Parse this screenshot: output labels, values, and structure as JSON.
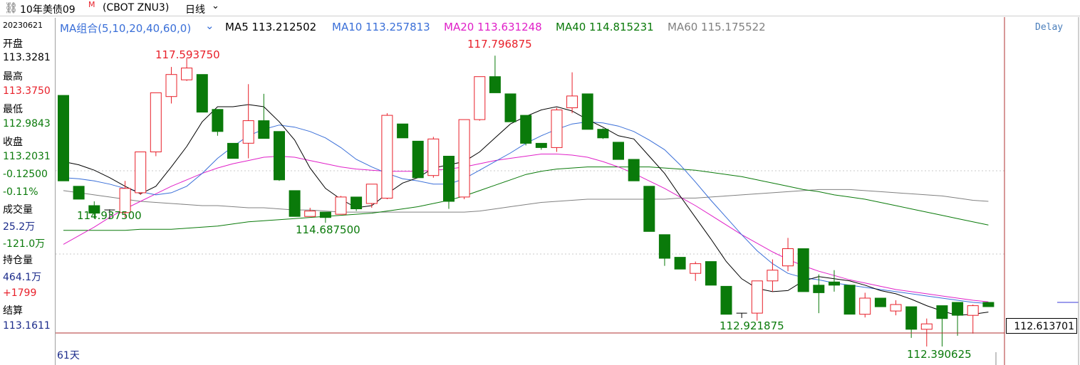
{
  "header": {
    "title": "10年美债09",
    "title_mark": "M",
    "symbol": "(CBOT ZNU3)",
    "period": "日线"
  },
  "sidebar": {
    "date": "20230621",
    "open_label": "开盘",
    "open_value": "113.3281",
    "high_label": "最高",
    "high_value": "113.3750",
    "low_label": "最低",
    "low_value": "112.9843",
    "close_label": "收盘",
    "close_value": "113.2031",
    "change": "-0.12500",
    "change_pct": "-0.11%",
    "volume_label": "成交量",
    "volume_value": "25.2万",
    "volume_change": "-121.0万",
    "oi_label": "持仓量",
    "oi_value": "464.1万",
    "oi_change": "+1799",
    "settle_label": "结算",
    "settle_value": "113.1611"
  },
  "legend": {
    "group": "MA组合(5,10,20,40,60,0)",
    "ma5": "MA5 113.212502",
    "ma10": "MA10 113.257813",
    "ma20": "MA20 113.631248",
    "ma40": "MA40 114.815231",
    "ma60": "MA60 115.175522"
  },
  "delay": "Delay",
  "days": "61天",
  "price_box": "112.613701",
  "annotations": {
    "a1": "117.593750",
    "a2": "117.796875",
    "a3": "114.937500",
    "a4": "114.687500",
    "a5": "112.921875",
    "a6": "112.390625"
  },
  "colors": {
    "up": "#e8202a",
    "down": "#0a7a0a",
    "ma5": "#000000",
    "ma10": "#3a6fd8",
    "ma20": "#e020c8",
    "ma40": "#0a7a0a",
    "ma60": "#808080"
  },
  "chart_data": {
    "type": "candlestick",
    "ylim": [
      112.35,
      118.2
    ],
    "candles": [
      {
        "o": 117.06,
        "h": 117.06,
        "c": 115.47,
        "l": 115.47
      },
      {
        "o": 115.37,
        "h": 115.37,
        "c": 115.13,
        "l": 115.13
      },
      {
        "o": 115.01,
        "h": 115.09,
        "c": 114.87,
        "l": 114.77
      },
      {
        "o": 114.93,
        "h": 114.94,
        "c": 114.93,
        "l": 114.77
      },
      {
        "o": 114.88,
        "h": 115.47,
        "c": 115.33,
        "l": 114.79
      },
      {
        "o": 115.25,
        "h": 116.01,
        "c": 116.01,
        "l": 115.21
      },
      {
        "o": 116.01,
        "h": 117.11,
        "c": 117.11,
        "l": 115.93
      },
      {
        "o": 117.04,
        "h": 117.59,
        "c": 117.45,
        "l": 116.91
      },
      {
        "o": 117.35,
        "h": 117.76,
        "c": 117.57,
        "l": 117.33
      },
      {
        "o": 117.45,
        "h": 117.45,
        "c": 116.75,
        "l": 116.75
      },
      {
        "o": 116.8,
        "h": 116.8,
        "c": 116.39,
        "l": 116.31
      },
      {
        "o": 116.17,
        "h": 116.17,
        "c": 115.89,
        "l": 115.89
      },
      {
        "o": 116.17,
        "h": 117.27,
        "c": 116.59,
        "l": 115.89
      },
      {
        "o": 116.59,
        "h": 117.09,
        "c": 116.26,
        "l": 116.26
      },
      {
        "o": 116.39,
        "h": 116.39,
        "c": 115.49,
        "l": 115.47
      },
      {
        "o": 115.29,
        "h": 115.29,
        "c": 114.81,
        "l": 114.81
      },
      {
        "o": 114.81,
        "h": 114.97,
        "c": 114.91,
        "l": 114.81
      },
      {
        "o": 114.89,
        "h": 114.89,
        "c": 114.79,
        "l": 114.69
      },
      {
        "o": 114.85,
        "h": 115.19,
        "c": 115.17,
        "l": 114.87
      },
      {
        "o": 115.17,
        "h": 115.17,
        "c": 114.95,
        "l": 114.91
      },
      {
        "o": 115.05,
        "h": 115.41,
        "c": 115.41,
        "l": 114.97
      },
      {
        "o": 115.15,
        "h": 116.73,
        "c": 116.69,
        "l": 115.13
      },
      {
        "o": 116.53,
        "h": 116.53,
        "c": 116.27,
        "l": 116.27
      },
      {
        "o": 116.21,
        "h": 116.21,
        "c": 115.53,
        "l": 115.53
      },
      {
        "o": 115.57,
        "h": 116.29,
        "c": 116.25,
        "l": 115.53
      },
      {
        "o": 115.93,
        "h": 115.93,
        "c": 115.09,
        "l": 114.95
      },
      {
        "o": 115.17,
        "h": 116.61,
        "c": 116.61,
        "l": 115.13
      },
      {
        "o": 116.61,
        "h": 117.41,
        "c": 117.41,
        "l": 116.59
      },
      {
        "o": 117.41,
        "h": 117.8,
        "c": 117.11,
        "l": 117.11
      },
      {
        "o": 117.09,
        "h": 117.09,
        "c": 116.57,
        "l": 116.57
      },
      {
        "o": 116.69,
        "h": 116.69,
        "c": 116.17,
        "l": 116.13
      },
      {
        "o": 116.17,
        "h": 116.17,
        "c": 116.09,
        "l": 116.05
      },
      {
        "o": 116.09,
        "h": 116.83,
        "c": 116.79,
        "l": 116.01
      },
      {
        "o": 116.83,
        "h": 117.49,
        "c": 117.05,
        "l": 116.73
      },
      {
        "o": 117.09,
        "h": 117.09,
        "c": 116.43,
        "l": 116.43
      },
      {
        "o": 116.43,
        "h": 116.45,
        "c": 116.27,
        "l": 116.25
      },
      {
        "o": 116.19,
        "h": 116.19,
        "c": 115.87,
        "l": 115.87
      },
      {
        "o": 115.87,
        "h": 115.87,
        "c": 115.47,
        "l": 115.47
      },
      {
        "o": 115.37,
        "h": 115.37,
        "c": 114.53,
        "l": 114.53
      },
      {
        "o": 114.47,
        "h": 114.47,
        "c": 114.03,
        "l": 113.89
      },
      {
        "o": 114.05,
        "h": 114.05,
        "c": 113.83,
        "l": 113.83
      },
      {
        "o": 113.75,
        "h": 113.97,
        "c": 113.93,
        "l": 113.61
      },
      {
        "o": 113.97,
        "h": 113.97,
        "c": 113.53,
        "l": 113.53
      },
      {
        "o": 113.51,
        "h": 113.51,
        "c": 112.99,
        "l": 112.99
      },
      {
        "o": 113.01,
        "h": 113.01,
        "c": 113.01,
        "l": 112.92
      },
      {
        "o": 113.01,
        "h": 113.59,
        "c": 113.61,
        "l": 112.87
      },
      {
        "o": 113.61,
        "h": 114.01,
        "c": 113.81,
        "l": 113.41
      },
      {
        "o": 113.89,
        "h": 114.41,
        "c": 114.21,
        "l": 113.79
      },
      {
        "o": 114.21,
        "h": 114.21,
        "c": 113.41,
        "l": 113.41
      },
      {
        "o": 113.53,
        "h": 113.73,
        "c": 113.39,
        "l": 113.01
      },
      {
        "o": 113.59,
        "h": 113.81,
        "c": 113.53,
        "l": 113.41
      },
      {
        "o": 113.53,
        "h": 113.53,
        "c": 112.99,
        "l": 112.99
      },
      {
        "o": 112.99,
        "h": 113.39,
        "c": 113.29,
        "l": 112.93
      },
      {
        "o": 113.29,
        "h": 113.29,
        "c": 113.13,
        "l": 113.13
      },
      {
        "o": 113.05,
        "h": 113.25,
        "c": 113.17,
        "l": 112.97
      },
      {
        "o": 113.13,
        "h": 113.13,
        "c": 112.71,
        "l": 112.55
      },
      {
        "o": 112.71,
        "h": 112.91,
        "c": 112.81,
        "l": 112.39
      },
      {
        "o": 113.15,
        "h": 113.15,
        "c": 112.91,
        "l": 112.39
      },
      {
        "o": 113.21,
        "h": 113.21,
        "c": 112.97,
        "l": 112.59
      },
      {
        "o": 112.97,
        "h": 113.17,
        "c": 113.15,
        "l": 112.63
      },
      {
        "o": 113.21,
        "h": 113.21,
        "c": 113.13,
        "l": 113.13
      }
    ],
    "ma5": [
      115.83,
      115.77,
      115.67,
      115.53,
      115.37,
      115.23,
      115.37,
      115.73,
      116.11,
      116.57,
      116.85,
      116.85,
      116.89,
      116.85,
      116.57,
      116.23,
      115.71,
      115.33,
      115.13,
      114.97,
      115.01,
      115.23,
      115.43,
      115.53,
      115.71,
      115.77,
      115.83,
      116.01,
      116.27,
      116.53,
      116.67,
      116.79,
      116.85,
      116.77,
      116.61,
      116.47,
      116.31,
      116.25,
      115.93,
      115.61,
      115.19,
      114.79,
      114.39,
      113.97,
      113.65,
      113.47,
      113.41,
      113.43,
      113.61,
      113.69,
      113.65,
      113.61,
      113.53,
      113.43,
      113.37,
      113.27,
      113.15,
      113.05,
      112.97,
      112.99,
      113.03
    ],
    "ma10": [
      115.53,
      115.51,
      115.47,
      115.41,
      115.33,
      115.27,
      115.21,
      115.25,
      115.37,
      115.61,
      115.89,
      116.11,
      116.31,
      116.43,
      116.51,
      116.47,
      116.39,
      116.27,
      116.09,
      115.87,
      115.73,
      115.61,
      115.51,
      115.47,
      115.41,
      115.41,
      115.51,
      115.67,
      115.83,
      115.99,
      116.17,
      116.31,
      116.43,
      116.53,
      116.57,
      116.55,
      116.49,
      116.39,
      116.23,
      116.05,
      115.77,
      115.45,
      115.11,
      114.79,
      114.47,
      114.17,
      113.93,
      113.75,
      113.67,
      113.63,
      113.57,
      113.53,
      113.49,
      113.45,
      113.41,
      113.37,
      113.33,
      113.29,
      113.25,
      113.21,
      113.19
    ],
    "ma20": [
      114.29,
      114.45,
      114.61,
      114.79,
      114.95,
      115.09,
      115.23,
      115.37,
      115.49,
      115.61,
      115.71,
      115.79,
      115.85,
      115.91,
      115.93,
      115.91,
      115.85,
      115.79,
      115.73,
      115.69,
      115.67,
      115.65,
      115.65,
      115.65,
      115.67,
      115.69,
      115.73,
      115.79,
      115.85,
      115.89,
      115.93,
      115.97,
      115.97,
      115.95,
      115.91,
      115.83,
      115.73,
      115.61,
      115.47,
      115.33,
      115.17,
      115.01,
      114.83,
      114.65,
      114.47,
      114.31,
      114.15,
      114.01,
      113.89,
      113.79,
      113.71,
      113.63,
      113.57,
      113.51,
      113.45,
      113.41,
      113.37,
      113.33,
      113.29,
      113.25,
      113.22
    ],
    "ma40": [
      114.55,
      114.55,
      114.55,
      114.55,
      114.55,
      114.57,
      114.57,
      114.57,
      114.59,
      114.61,
      114.63,
      114.67,
      114.71,
      114.73,
      114.75,
      114.77,
      114.79,
      114.81,
      114.83,
      114.85,
      114.87,
      114.91,
      114.95,
      114.99,
      115.05,
      115.11,
      115.19,
      115.29,
      115.39,
      115.49,
      115.59,
      115.65,
      115.69,
      115.71,
      115.73,
      115.73,
      115.73,
      115.73,
      115.73,
      115.71,
      115.69,
      115.67,
      115.63,
      115.59,
      115.55,
      115.49,
      115.43,
      115.37,
      115.31,
      115.27,
      115.21,
      115.17,
      115.13,
      115.07,
      115.01,
      114.95,
      114.89,
      114.83,
      114.77,
      114.71,
      114.65
    ],
    "ma60": [
      115.29,
      115.25,
      115.21,
      115.17,
      115.13,
      115.09,
      115.07,
      115.05,
      115.03,
      115.01,
      115.01,
      114.99,
      114.97,
      114.97,
      114.95,
      114.93,
      114.93,
      114.91,
      114.89,
      114.89,
      114.89,
      114.89,
      114.89,
      114.89,
      114.89,
      114.89,
      114.89,
      114.91,
      114.95,
      114.99,
      115.03,
      115.07,
      115.09,
      115.11,
      115.13,
      115.13,
      115.13,
      115.13,
      115.13,
      115.13,
      115.15,
      115.15,
      115.17,
      115.19,
      115.21,
      115.23,
      115.25,
      115.27,
      115.29,
      115.31,
      115.31,
      115.31,
      115.29,
      115.27,
      115.25,
      115.23,
      115.21,
      115.19,
      115.15,
      115.11,
      115.09
    ]
  }
}
